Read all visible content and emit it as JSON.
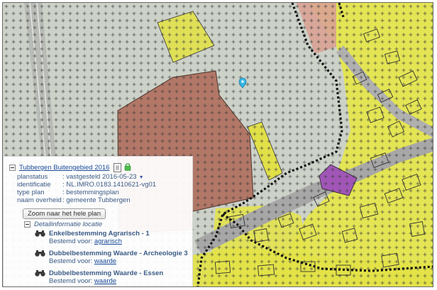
{
  "map": {
    "legend_colors": {
      "agrarisch_bg": "#cfd3ca",
      "dots": "#3a3a3a",
      "recreatie": "#b27a6b",
      "wonen": "#e8e845",
      "bedrijf": "#a358b4",
      "road": "#a9a9a9",
      "boundary": "#111111",
      "marker": "#35b6e6"
    },
    "marker_icon": "location-pin-icon"
  },
  "panel": {
    "plan_title": "Tubbergen Buitengebied 2016",
    "plan_doc_icon": "document-icon",
    "plan_lock_icon": "lock-icon",
    "properties": [
      {
        "key": "planstatus",
        "value": ": vastgesteld 2016-05-23"
      },
      {
        "key": "identificatie",
        "value": ": NL.IMRO.0183.1410621-vg01"
      },
      {
        "key": "type plan",
        "value": ": bestemmingsplan"
      },
      {
        "key": "naam overheid",
        "value": ": gemeente Tubbergen"
      }
    ],
    "download_icon": "download-icon",
    "zoom_button": "Zoom naar het hele plan",
    "detail_title": "Detailinformatie locatie",
    "bestemmingen": [
      {
        "title": "Enkelbestemming Agrarisch - 1",
        "sub_label": "Bestemd voor:",
        "link": "agrarisch"
      },
      {
        "title": "Dubbelbestemming Waarde - Archeologie 3",
        "sub_label": "Bestemd voor:",
        "link": "waarde"
      },
      {
        "title": "Dubbelbestemming Waarde - Essen",
        "sub_label": "Bestemd voor:",
        "link": "waarde"
      }
    ]
  }
}
